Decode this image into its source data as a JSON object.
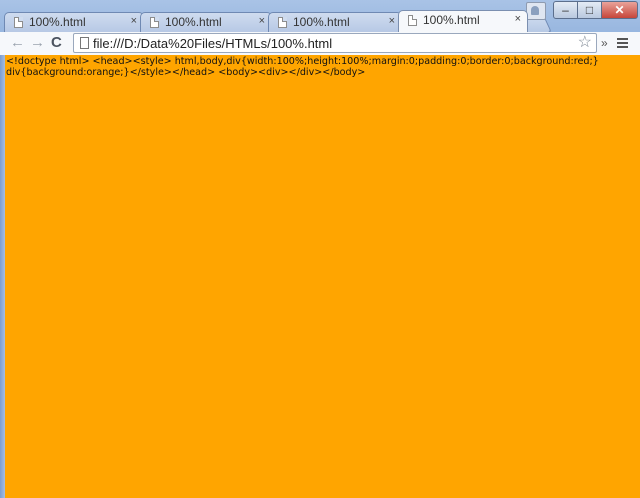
{
  "browser": {
    "tabs": [
      {
        "label": "100%.html",
        "close": "×",
        "active": false
      },
      {
        "label": "100%.html",
        "close": "×",
        "active": false
      },
      {
        "label": "100%.html",
        "close": "×",
        "active": false
      },
      {
        "label": "100%.html",
        "close": "×",
        "active": true
      }
    ],
    "window_controls": {
      "minimize": "–",
      "maximize": "□",
      "close": "✕"
    },
    "toolbar": {
      "back": "←",
      "forward": "→",
      "reload": "C",
      "url": "file:///D:/Data%20Files/HTMLs/100%.html",
      "star": "☆",
      "extensions_more": "»"
    }
  },
  "page": {
    "source_text": "<!doctype html> <head><style> html,body,div{width:100%;height:100%;margin:0;padding:0;border:0;background:red;} div{background:orange;}</style></head> <body><div></div></body>",
    "background_color": "#ffa500"
  },
  "colors": {
    "frame": "#7a9fd3",
    "toolbar": "#f6f8fb",
    "content": "#ffa500"
  }
}
